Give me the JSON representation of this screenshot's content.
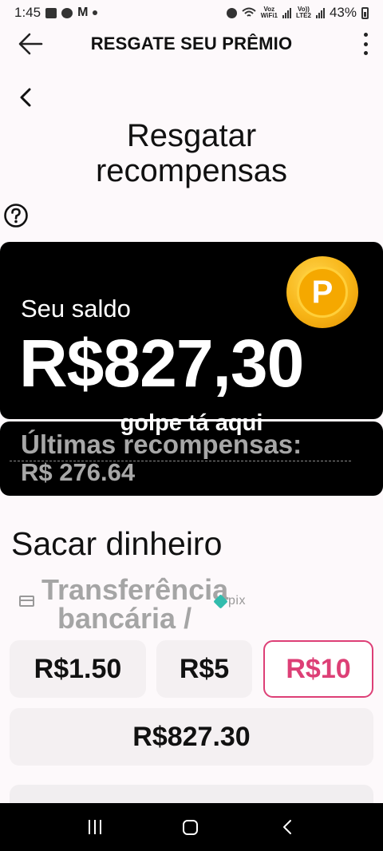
{
  "status_bar": {
    "time": "1:45",
    "battery": "43%",
    "volte_label_1": "Voz\nWiFi1",
    "volte_label_2": "Vo))\nLTE2"
  },
  "app_bar": {
    "title": "RESGATE SEU PRÊMIO",
    "back_icon": "arrow-left-icon",
    "menu_icon": "kebab-menu-icon"
  },
  "page": {
    "title_line1": "Resgatar",
    "title_line2": "recompensas",
    "help_icon": "question-circle-icon"
  },
  "balance_card": {
    "label": "Seu saldo",
    "value": "R$827,30",
    "coin_letter": "P",
    "overlay_text": "golpe tá aqui"
  },
  "recent_card": {
    "label": "Últimas recompensas:",
    "value": "R$ 276.64"
  },
  "withdraw": {
    "title": "Sacar dinheiro",
    "method_line1": "Transferência",
    "method_line2": "bancária /",
    "pix_text": "pix",
    "amounts": [
      {
        "label": "R$1.50",
        "selected": false
      },
      {
        "label": "R$5",
        "selected": false
      },
      {
        "label": "R$10",
        "selected": true
      },
      {
        "label": "R$827.30",
        "selected": false
      }
    ],
    "selected_color": "#dd3f76"
  },
  "colors": {
    "card_bg": "#000000",
    "accent": "#dd3f76",
    "coin": "#f5a800",
    "pix": "#32bcad"
  }
}
